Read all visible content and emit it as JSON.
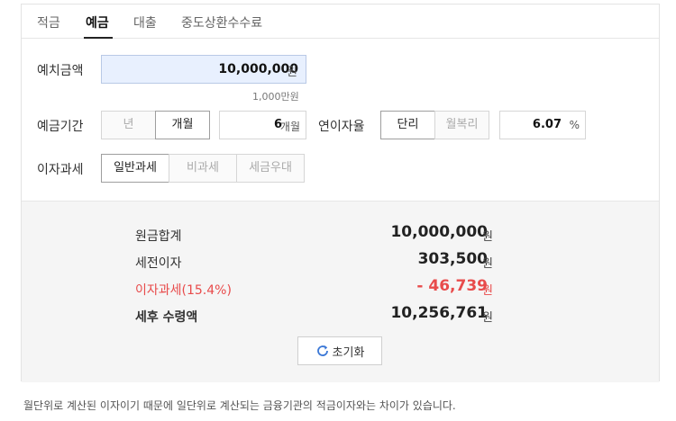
{
  "tabs": [
    {
      "label": "적금"
    },
    {
      "label": "예금"
    },
    {
      "label": "대출"
    },
    {
      "label": "중도상환수수료"
    }
  ],
  "deposit_amount": {
    "label": "예치금액",
    "value": "10,000,000",
    "unit": "원",
    "sub_text": "1,000만원"
  },
  "deposit_period": {
    "label": "예금기간",
    "options": [
      "년",
      "개월"
    ],
    "selected": "개월",
    "value": "6",
    "unit": "개월"
  },
  "annual_rate": {
    "label": "연이자율",
    "options": [
      "단리",
      "월복리"
    ],
    "selected": "단리",
    "value": "6.07",
    "unit": "%"
  },
  "interest_tax": {
    "label": "이자과세",
    "options": [
      "일반과세",
      "비과세",
      "세금우대"
    ],
    "selected": "일반과세"
  },
  "results": {
    "principal_label": "원금합계",
    "principal_value": "10,000,000",
    "pretax_label": "세전이자",
    "pretax_value": "303,500",
    "tax_label": "이자과세(15.4%)",
    "tax_value": "- 46,739",
    "net_label": "세후 수령액",
    "net_value": "10,256,761",
    "unit": "원"
  },
  "reset_label": "초기화",
  "note": "월단위로 계산된 이자이기 때문에 일단위로 계산되는 금융기관의 적금이자와는 차이가 있습니다.",
  "colors": {
    "accent_red": "#e84b4b",
    "amount_bg": "#e8f0fe"
  }
}
